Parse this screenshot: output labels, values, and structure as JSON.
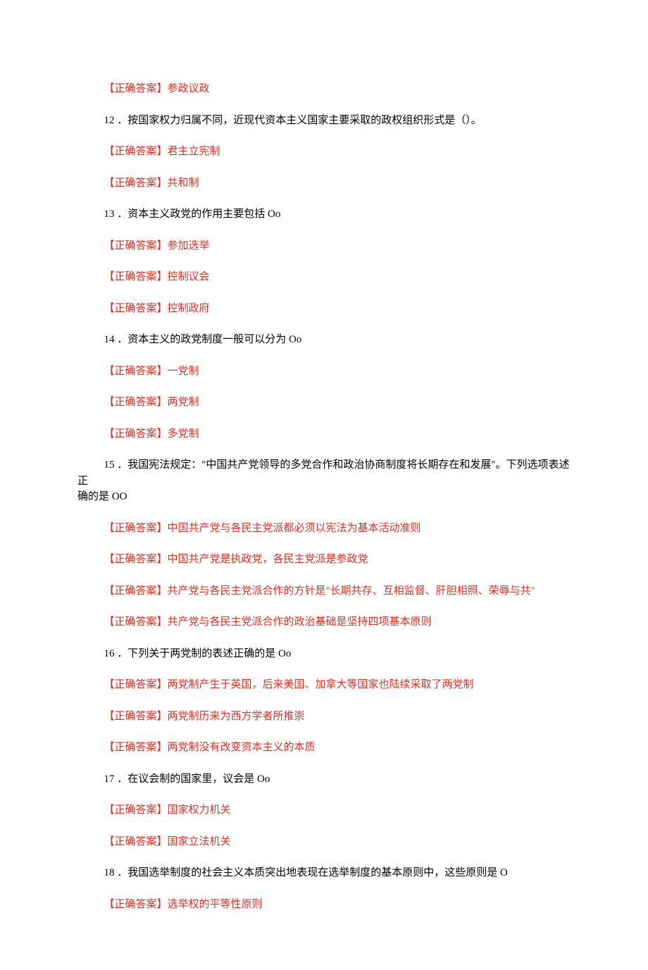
{
  "items": [
    {
      "type": "answer",
      "text": "【正确答案】参政议政"
    },
    {
      "type": "question",
      "text": "12 ．按国家权力归属不同，近现代资本主义国家主要采取的政权组织形式是（）。"
    },
    {
      "type": "answer",
      "text": "【正确答案】君主立宪制"
    },
    {
      "type": "answer",
      "text": "【正确答案】共和制"
    },
    {
      "type": "question",
      "text": "13 ．资本主义政党的作用主要包括 Oo"
    },
    {
      "type": "answer",
      "text": "【正确答案】参加选举"
    },
    {
      "type": "answer",
      "text": "【正确答案】控制议会"
    },
    {
      "type": "answer",
      "text": "【正确答案】控制政府"
    },
    {
      "type": "question",
      "text": "14 ．资本主义的政党制度一般可以分为 Oo"
    },
    {
      "type": "answer",
      "text": "【正确答案】一党制"
    },
    {
      "type": "answer",
      "text": "【正确答案】两党制"
    },
    {
      "type": "answer",
      "text": "【正确答案】多党制"
    },
    {
      "type": "question-wrap",
      "line1": "15 ．我国宪法规定：\"中国共产党领导的多党合作和政治协商制度将长期存在和发展\"。下列选项表述正",
      "line2": "确的是 OO"
    },
    {
      "type": "answer",
      "text": "【正确答案】中国共产党与各民主党派都必须以宪法为基本活动准则"
    },
    {
      "type": "answer",
      "text": "【正确答案】中国共产党是执政党，各民主党派是参政党"
    },
    {
      "type": "answer",
      "text": "【正确答案】共产党与各民主党派合作的方针是\"长期共存、互相监督、肝胆相照、荣辱与共\""
    },
    {
      "type": "answer",
      "text": "【正确答案】共产党与各民主党派合作的政治基础是坚持四项基本原则"
    },
    {
      "type": "question",
      "text": "16 ．下列关于两党制的表述正确的是 Oo"
    },
    {
      "type": "answer",
      "text": "【正确答案】两党制产生于英国，后来美国、加拿大等国家也陆续采取了两党制"
    },
    {
      "type": "answer",
      "text": "【正确答案】两党制历来为西方学者所推崇"
    },
    {
      "type": "answer",
      "text": "【正确答案】两党制没有改变资本主义的本质"
    },
    {
      "type": "question",
      "text": "17 ．在议会制的国家里，议会是 Oo"
    },
    {
      "type": "answer",
      "text": "【正确答案】国家权力机关"
    },
    {
      "type": "answer",
      "text": "【正确答案】国家立法机关"
    },
    {
      "type": "question",
      "text": "18 ．我国选举制度的社会主义本质突出地表现在选举制度的基本原则中，这些原则是 O"
    },
    {
      "type": "answer",
      "text": "【正确答案】选举权的平等性原则"
    }
  ]
}
